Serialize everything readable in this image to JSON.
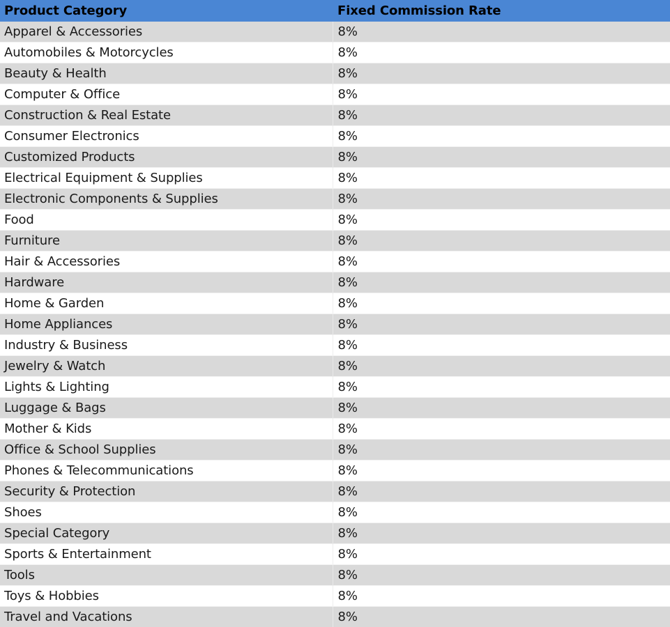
{
  "table": {
    "name": "Product Category Fixed Commission Rate Table",
    "header_background_color": "#4a86d4",
    "header_text_color": "#000000",
    "row_shaded_color": "#d9d9d9",
    "row_plain_color": "#ffffff",
    "columns": [
      {
        "key": "category",
        "label": "Product Category"
      },
      {
        "key": "rate",
        "label": "Fixed Commission Rate"
      }
    ],
    "rows": [
      {
        "category": "Apparel & Accessories",
        "rate": "8%"
      },
      {
        "category": "Automobiles & Motorcycles",
        "rate": "8%"
      },
      {
        "category": "Beauty & Health",
        "rate": "8%"
      },
      {
        "category": "Computer & Office",
        "rate": "8%"
      },
      {
        "category": "Construction & Real Estate",
        "rate": "8%"
      },
      {
        "category": "Consumer Electronics",
        "rate": "8%"
      },
      {
        "category": "Customized Products",
        "rate": "8%"
      },
      {
        "category": "Electrical Equipment & Supplies",
        "rate": "8%"
      },
      {
        "category": "Electronic Components & Supplies",
        "rate": "8%"
      },
      {
        "category": "Food",
        "rate": "8%"
      },
      {
        "category": "Furniture",
        "rate": "8%"
      },
      {
        "category": "Hair & Accessories",
        "rate": "8%"
      },
      {
        "category": "Hardware",
        "rate": "8%"
      },
      {
        "category": "Home & Garden",
        "rate": "8%"
      },
      {
        "category": "Home Appliances",
        "rate": "8%"
      },
      {
        "category": "Industry & Business",
        "rate": "8%"
      },
      {
        "category": "Jewelry & Watch",
        "rate": "8%"
      },
      {
        "category": "Lights & Lighting",
        "rate": "8%"
      },
      {
        "category": "Luggage & Bags",
        "rate": "8%"
      },
      {
        "category": "Mother & Kids",
        "rate": "8%"
      },
      {
        "category": "Office & School Supplies",
        "rate": "8%"
      },
      {
        "category": "Phones & Telecommunications",
        "rate": "8%"
      },
      {
        "category": "Security & Protection",
        "rate": "8%"
      },
      {
        "category": "Shoes",
        "rate": "8%"
      },
      {
        "category": "Special Category",
        "rate": "8%"
      },
      {
        "category": "Sports & Entertainment",
        "rate": "8%"
      },
      {
        "category": "Tools",
        "rate": "8%"
      },
      {
        "category": "Toys & Hobbies",
        "rate": "8%"
      },
      {
        "category": "Travel and Vacations",
        "rate": "8%"
      }
    ]
  }
}
